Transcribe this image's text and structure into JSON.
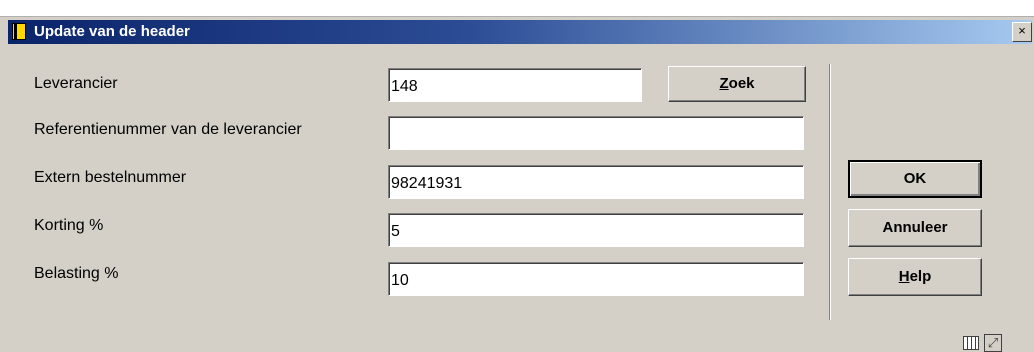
{
  "window": {
    "title": "Update van de header",
    "close_glyph": "×",
    "icon": "book-icon"
  },
  "form": {
    "leverancier": {
      "label": "Leverancier",
      "value": "148"
    },
    "referentie": {
      "label": "Referentienummer van de leverancier",
      "value": ""
    },
    "extern": {
      "label": "Extern bestelnummer",
      "value": "98241931"
    },
    "korting": {
      "label": "Korting %",
      "value": "5"
    },
    "belasting": {
      "label": "Belasting %",
      "value": "10"
    }
  },
  "buttons": {
    "zoek": {
      "mnemonic": "Z",
      "rest": "oek"
    },
    "ok": {
      "label": "OK"
    },
    "annuleer": {
      "label": "Annuleer"
    },
    "help": {
      "mnemonic": "H",
      "rest": "elp"
    }
  },
  "status_icons": [
    "grid-icon",
    "expand-icon"
  ],
  "colors": {
    "titlebar_start": "#0a246a",
    "titlebar_end": "#a6caf0",
    "dialog_bg": "#d4d0c8"
  }
}
